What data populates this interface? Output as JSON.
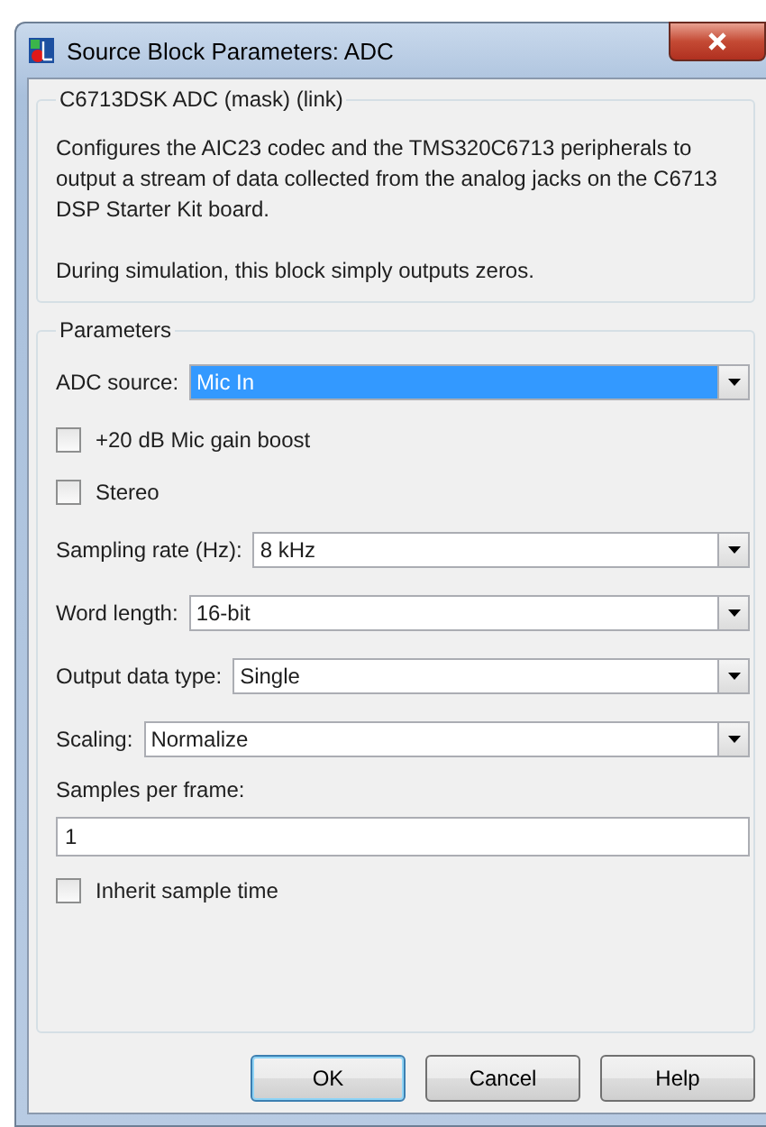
{
  "window": {
    "title": "Source Block Parameters: ADC"
  },
  "description": {
    "title": "C6713DSK ADC (mask) (link)",
    "paragraphs": [
      "Configures the AIC23 codec and the TMS320C6713 peripherals to output a stream of data collected from the analog jacks on the C6713 DSP Starter Kit board.",
      "During simulation, this block simply outputs zeros."
    ]
  },
  "parameters": {
    "title": "Parameters",
    "items": [
      {
        "kind": "dropdown",
        "label": "ADC source:",
        "value": "Mic In",
        "focused": true
      },
      {
        "kind": "checkbox",
        "label": "+20 dB Mic gain boost",
        "checked": false
      },
      {
        "kind": "checkbox",
        "label": "Stereo",
        "checked": false
      },
      {
        "kind": "dropdown",
        "label": "Sampling rate (Hz):",
        "value": "8 kHz",
        "focused": false
      },
      {
        "kind": "dropdown",
        "label": "Word length:",
        "value": "16-bit",
        "focused": false
      },
      {
        "kind": "dropdown",
        "label": "Output data type:",
        "value": "Single",
        "focused": false
      },
      {
        "kind": "dropdown",
        "label": "Scaling:",
        "value": "Normalize",
        "focused": false
      },
      {
        "kind": "textfield",
        "label": "Samples per frame:",
        "value": "1"
      },
      {
        "kind": "checkbox",
        "label": "Inherit sample time",
        "checked": false
      }
    ]
  },
  "buttons": [
    {
      "label": "OK",
      "default": true
    },
    {
      "label": "Cancel",
      "default": false
    },
    {
      "label": "Help",
      "default": false
    }
  ]
}
